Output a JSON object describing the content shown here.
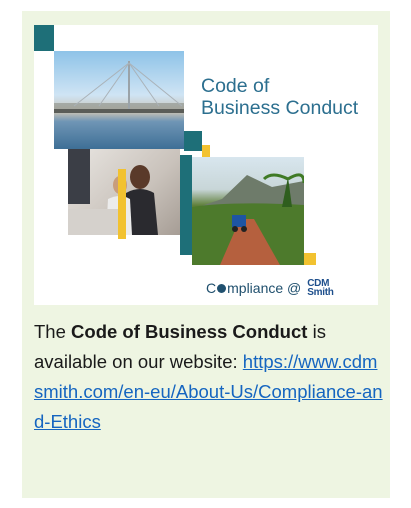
{
  "cover": {
    "title_line1": "Code of",
    "title_line2": "Business Conduct",
    "brand_prefix": "C",
    "brand_suffix": "mpliance @",
    "logo_top": "CDM",
    "logo_bottom": "Smith"
  },
  "caption": {
    "before": "The ",
    "bold": "Code of Business Conduct",
    "after": " is available on our website: ",
    "link": "https://www.cdmsmith.com/en-eu/About-Us/Compliance-and-Ethics"
  },
  "colors": {
    "card_bg": "#eef5e2",
    "teal": "#1e6f78",
    "yellow": "#f2c230",
    "link": "#1565c0",
    "title_blue": "#2c6f8f"
  }
}
